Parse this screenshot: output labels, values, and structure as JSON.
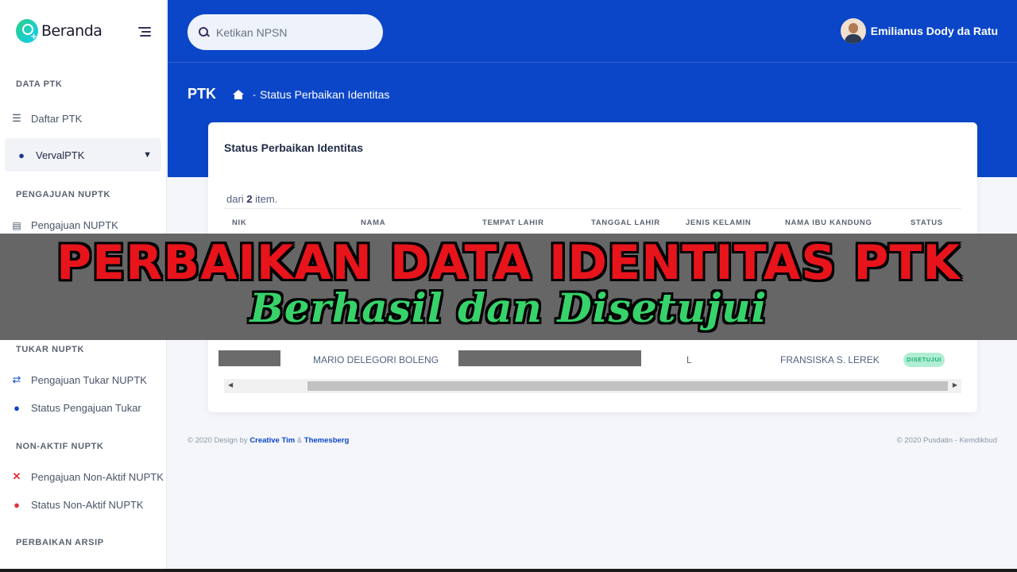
{
  "sidebar": {
    "brand": "Beranda",
    "sections": {
      "data_ptk": "DATA PTK",
      "pengajuan_nuptk": "PENGAJUAN NUPTK",
      "tukar_nuptk": "TUKAR NUPTK",
      "nonaktif_nuptk": "NON-AKTIF NUPTK",
      "perbaikan_arsip": "PERBAIKAN ARSIP"
    },
    "items": {
      "daftar_ptk": "Daftar PTK",
      "verval_ptk": "VervalPTK",
      "pengajuan_nuptk": "Pengajuan NUPTK",
      "pengajuan_tukar": "Pengajuan Tukar NUPTK",
      "status_tukar": "Status Pengajuan Tukar",
      "pengajuan_nonaktif": "Pengajuan Non-Aktif NUPTK",
      "status_nonaktif": "Status Non-Aktif NUPTK"
    }
  },
  "header": {
    "search_placeholder": "Ketikan NPSN",
    "user_name": "Emilianus Dody da Ratu",
    "page_title": "PTK",
    "breadcrumb_sep": "-",
    "breadcrumb_current": "Status Perbaikan Identitas"
  },
  "card": {
    "title": "Status Perbaikan Identitas",
    "summary_prefix": "dari",
    "summary_count": "2",
    "summary_suffix": "item.",
    "columns": {
      "nik": "NIK",
      "nama": "NAMA",
      "tempat_lahir": "TEMPAT LAHIR",
      "tanggal_lahir": "TANGGAL LAHIR",
      "jenis_kelamin": "JENIS KELAMIN",
      "nama_ibu": "NAMA IBU KANDUNG",
      "status": "STATUS"
    },
    "row": {
      "nama": "MARIO DELEGORI BOLENG",
      "jenis_kelamin": "L",
      "nama_ibu": "FRANSISKA S. LEREK",
      "status": "DISETUJUI"
    }
  },
  "footer": {
    "left_prefix": "© 2020 Design by",
    "link1": "Creative Tim",
    "amp": "&",
    "link2": "Themesberg",
    "right": "© 2020 Pusdatin - Kemdikbud"
  },
  "banner": {
    "title": "PERBAIKAN DATA IDENTITAS PTK",
    "subtitle": "Berhasil dan Disetujui"
  },
  "colors": {
    "primary": "#0b46c8",
    "banner_title": "#e8141b",
    "banner_subtitle": "#37d36a",
    "status_badge": "#b0eed3"
  }
}
